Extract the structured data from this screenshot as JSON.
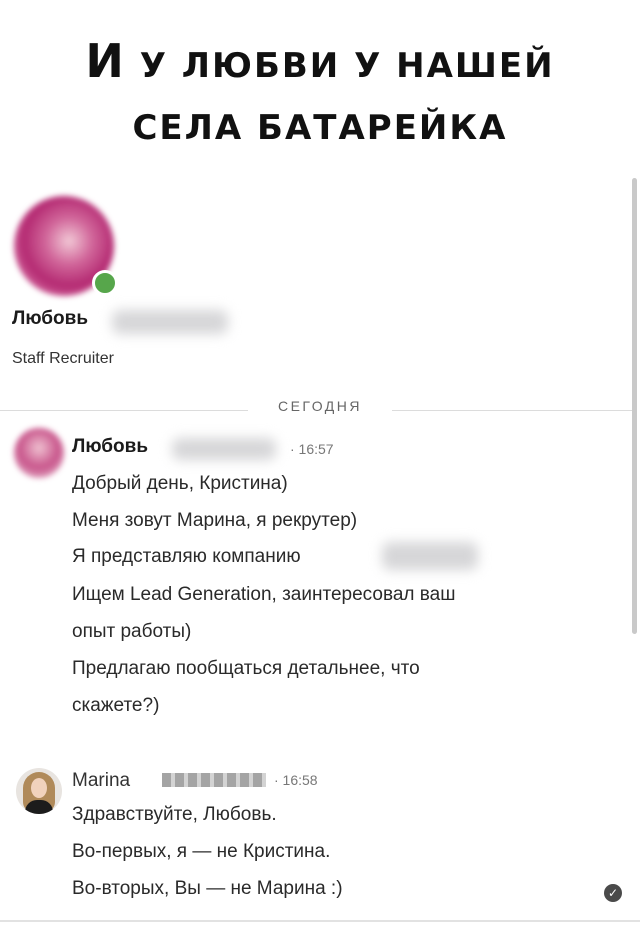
{
  "meme": {
    "line1_big": "И",
    "line1_rest": " У ЛЮБВИ У НАШЕЙ",
    "line2": "СЕЛА БАТАРЕЙКА"
  },
  "profile": {
    "name": "Любовь",
    "role": "Staff Recruiter"
  },
  "date_separator": "СЕГОДНЯ",
  "messages": [
    {
      "sender": "Любовь",
      "time": "· 16:57",
      "lines": [
        "Добрый день, Кристина)",
        "Меня зовут Марина, я рекрутер)",
        "Я представляю компанию",
        "Ищем Lead Generation, заинтересовал ваш",
        "опыт работы)",
        "Предлагаю пообщаться детальнее, что",
        "скажете?)"
      ]
    },
    {
      "sender": "Marina",
      "time": "· 16:58",
      "lines": [
        "Здравствуйте, Любовь.",
        "Во-первых, я — не Кристина.",
        "Во-вторых, Вы — не Марина :)"
      ]
    }
  ],
  "icons": {
    "read_receipt": "check-circle-icon",
    "online_status": "online-dot-icon"
  },
  "colors": {
    "online": "#57a64b",
    "avatar_pink": "#b42a72"
  }
}
